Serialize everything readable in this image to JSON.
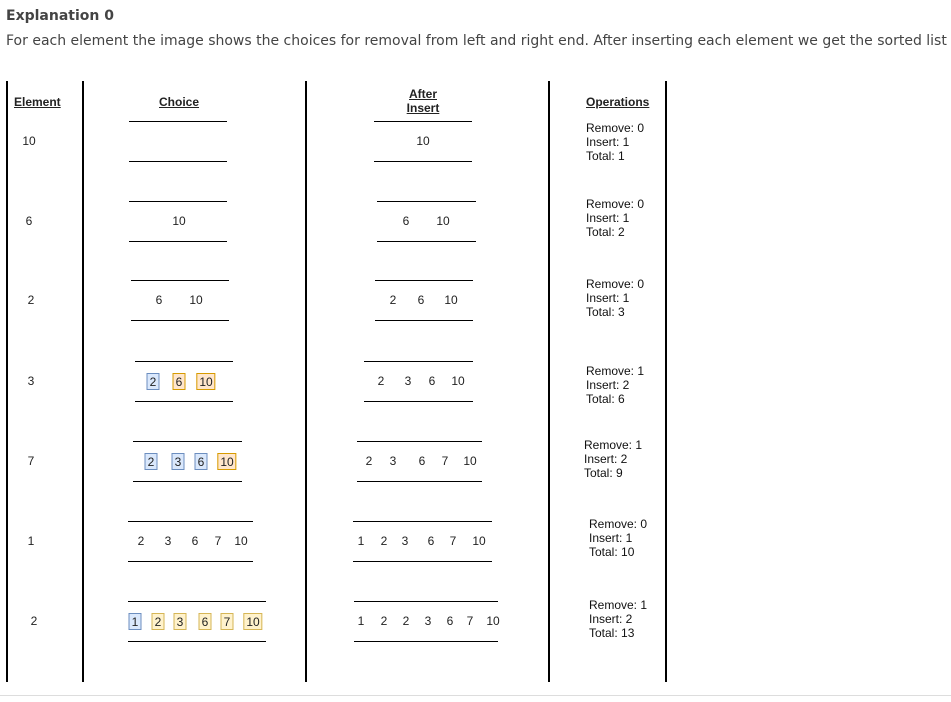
{
  "heading": "Explanation 0",
  "intro": "For each element the image shows the choices for removal from left and right end. After inserting each element we get the sorted list by us",
  "headers": {
    "element": "Element",
    "choice": "Choice",
    "after_line1": "After",
    "after_line2": "Insert",
    "operations": "Operations"
  },
  "rows": [
    {
      "element": "10",
      "choice": [],
      "after": [
        "10"
      ],
      "ops": {
        "remove": "Remove: 0",
        "insert": "Insert: 1",
        "total": "Total: 1"
      }
    },
    {
      "element": "6",
      "choice": [
        {
          "v": "10",
          "c": "none"
        }
      ],
      "after": [
        "6",
        "10"
      ],
      "ops": {
        "remove": "Remove: 0",
        "insert": "Insert: 1",
        "total": "Total: 2"
      }
    },
    {
      "element": "2",
      "choice": [
        {
          "v": "6",
          "c": "none"
        },
        {
          "v": "10",
          "c": "none"
        }
      ],
      "after": [
        "2",
        "6",
        "10"
      ],
      "ops": {
        "remove": "Remove: 0",
        "insert": "Insert: 1",
        "total": "Total: 3"
      }
    },
    {
      "element": "3",
      "choice": [
        {
          "v": "2",
          "c": "blue"
        },
        {
          "v": "6",
          "c": "orange"
        },
        {
          "v": "10",
          "c": "orange"
        }
      ],
      "after": [
        "2",
        "3",
        "6",
        "10"
      ],
      "ops": {
        "remove": "Remove: 1",
        "insert": "Insert: 2",
        "total": "Total: 6"
      }
    },
    {
      "element": "7",
      "choice": [
        {
          "v": "2",
          "c": "blue"
        },
        {
          "v": "3",
          "c": "blue"
        },
        {
          "v": "6",
          "c": "blue"
        },
        {
          "v": "10",
          "c": "orange"
        }
      ],
      "after": [
        "2",
        "3",
        "6",
        "7",
        "10"
      ],
      "ops": {
        "remove": "Remove: 1",
        "insert": "Insert: 2",
        "total": "Total: 9"
      }
    },
    {
      "element": "1",
      "choice": [
        {
          "v": "2",
          "c": "none"
        },
        {
          "v": "3",
          "c": "none"
        },
        {
          "v": "6",
          "c": "none"
        },
        {
          "v": "7",
          "c": "none"
        },
        {
          "v": "10",
          "c": "none"
        }
      ],
      "after": [
        "1",
        "2",
        "3",
        "6",
        "7",
        "10"
      ],
      "ops": {
        "remove": "Remove: 0",
        "insert": "Insert: 1",
        "total": "Total: 10"
      }
    },
    {
      "element": "2",
      "choice": [
        {
          "v": "1",
          "c": "blue"
        },
        {
          "v": "2",
          "c": "yellow"
        },
        {
          "v": "3",
          "c": "yellow"
        },
        {
          "v": "6",
          "c": "yellow"
        },
        {
          "v": "7",
          "c": "yellow"
        },
        {
          "v": "10",
          "c": "yellow"
        }
      ],
      "after": [
        "1",
        "2",
        "2",
        "3",
        "6",
        "7",
        "10"
      ],
      "ops": {
        "remove": "Remove: 1",
        "insert": "Insert: 2",
        "total": "Total: 13"
      }
    }
  ]
}
